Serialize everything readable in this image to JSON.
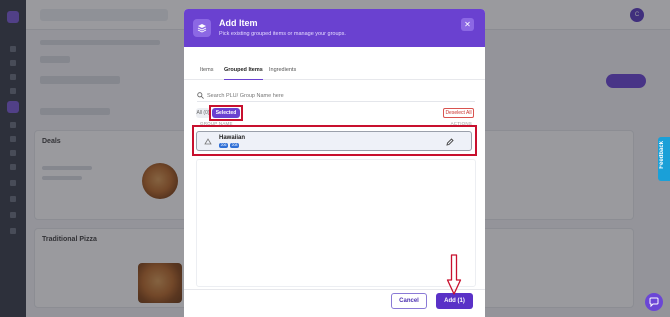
{
  "background": {
    "section_title": "Deals",
    "second_section_title": "Traditional Pizza",
    "avatar_initial": "C"
  },
  "modal": {
    "title": "Add Item",
    "subtitle": "Pick existing grouped items or manage your groups.",
    "close_icon": "close-icon",
    "tabs": [
      {
        "label": "Items",
        "active": false
      },
      {
        "label": "Grouped Items",
        "active": true
      },
      {
        "label": "Ingredients",
        "active": false
      }
    ],
    "search": {
      "placeholder": "Search PLU/ Group Name here",
      "value": ""
    },
    "filters": {
      "all_label": "All (0)",
      "selected_label": "Selected (1)"
    },
    "deselect_all_label": "Deselect All",
    "columns": {
      "group_name": "GROUP NAME",
      "actions": "ACTIONS"
    },
    "groups": [
      {
        "name": "Hawaiian",
        "badges": [
          "206",
          "208"
        ],
        "selected": true
      }
    ],
    "footer": {
      "cancel_label": "Cancel",
      "add_label": "Add (1)"
    }
  },
  "feedback_label": "Feedback",
  "colors": {
    "accent": "#6a41d0",
    "highlight": "#c8102e",
    "badge": "#2f6fd6"
  }
}
